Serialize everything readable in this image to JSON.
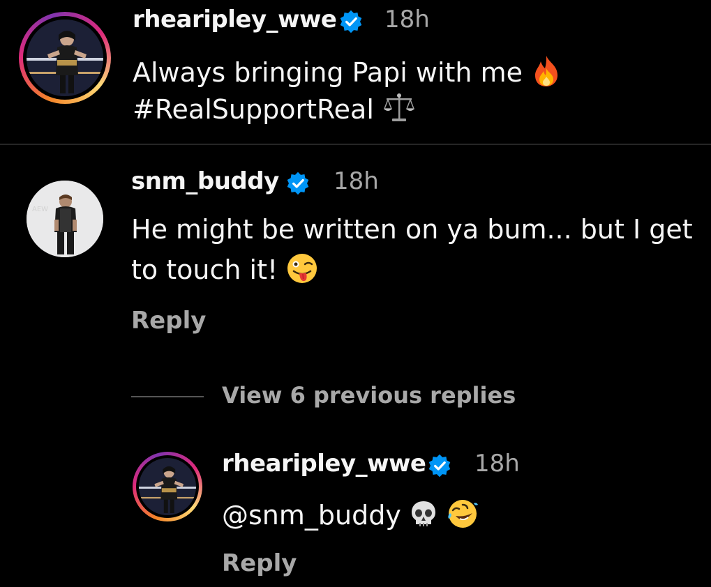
{
  "caption": {
    "username": "rhearipley_wwe",
    "timestamp": "18h",
    "line1": "Always bringing Papi with me",
    "line2": "#RealSupportReal",
    "emoji_line1": "fire-emoji",
    "emoji_line2": "scales-emoji"
  },
  "comment": {
    "username": "snm_buddy",
    "timestamp": "18h",
    "line1": "He might be written on ya bum... but I get",
    "line2": "to touch it!",
    "emoji": "winking-tongue-emoji",
    "reply_label": "Reply"
  },
  "view_previous": {
    "label": "View 6 previous replies"
  },
  "reply_comment": {
    "username": "rhearipley_wwe",
    "timestamp": "18h",
    "text": "@snm_buddy",
    "emojis": [
      "skull-emoji",
      "rolling-laughing-emoji"
    ],
    "reply_label": "Reply"
  },
  "colors": {
    "background": "#000000",
    "primary_text": "#f5f5f5",
    "secondary_text": "#a8a8a8",
    "verified_blue": "#0095f6",
    "divider": "#262626"
  }
}
